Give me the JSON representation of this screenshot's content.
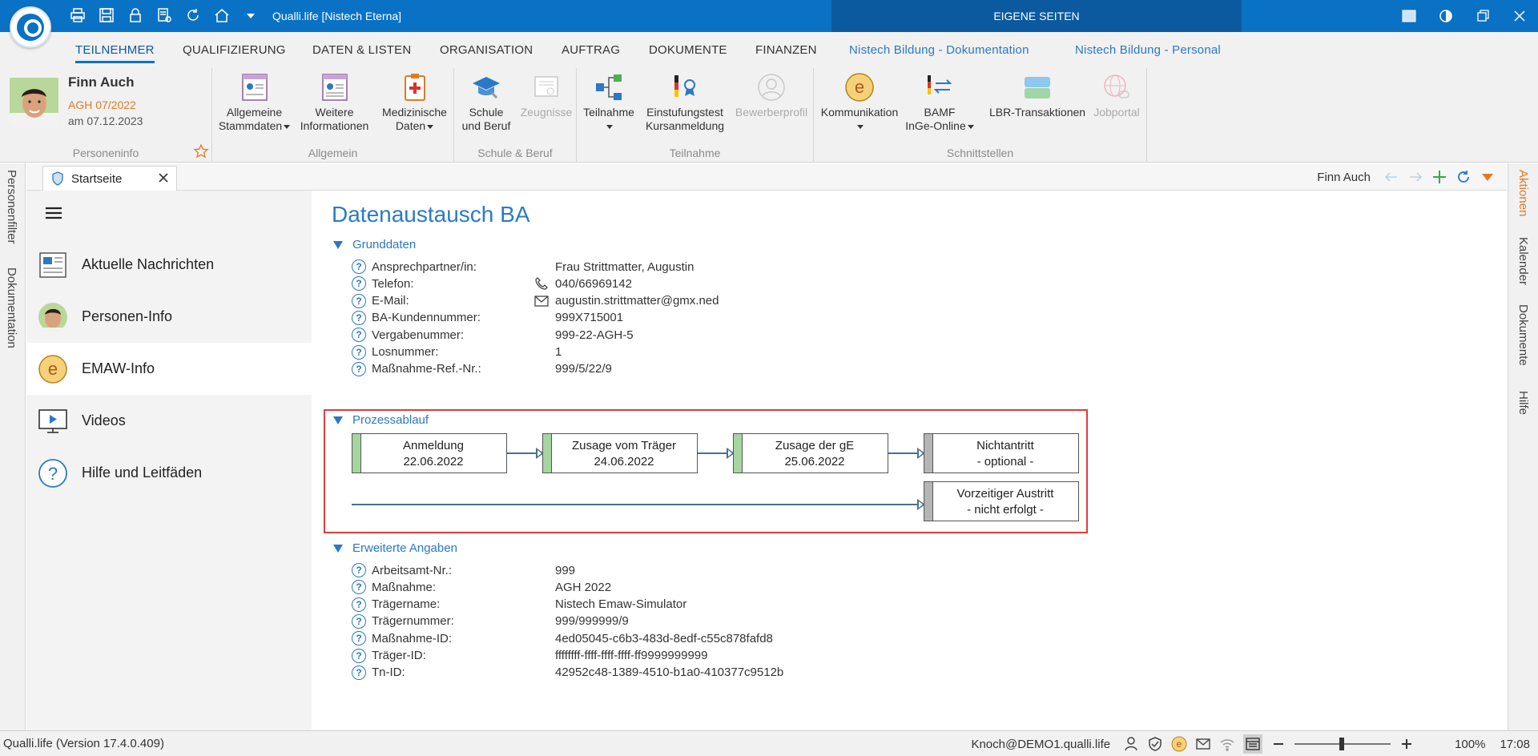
{
  "titlebar": {
    "app_title": "Qualli.life [Nistech Eterna]",
    "eigene_seiten": "EIGENE SEITEN",
    "quick_access": [
      "print-icon",
      "save-icon",
      "lock-icon",
      "form-settings-icon",
      "refresh-icon",
      "home-icon",
      "dropdown-icon"
    ],
    "window_controls": [
      "theme-square-icon",
      "contrast-icon",
      "restore-icon",
      "close-icon"
    ],
    "accent": "#0a72c4"
  },
  "ribbon_tabs": [
    "TEILNEHMER",
    "QUALIFIZIERUNG",
    "DATEN & LISTEN",
    "ORGANISATION",
    "AUFTRAG",
    "DOKUMENTE",
    "FINANZEN",
    "Nistech Bildung - Dokumentation",
    "Nistech Bildung - Personal"
  ],
  "person": {
    "name": "Finn Auch",
    "agh": "AGH 07/2022",
    "date": "am 07.12.2023",
    "group_label": "Personeninfo"
  },
  "ribbon": {
    "allgemein": {
      "label": "Allgemein",
      "b1": [
        "Allgemeine",
        "Stammdaten"
      ],
      "b2": [
        "Weitere",
        "Informationen"
      ],
      "b3": [
        "Medizinische",
        "Daten"
      ]
    },
    "schule": {
      "label": "Schule & Beruf",
      "b1": [
        "Schule",
        "und Beruf"
      ],
      "b2": "Zeugnisse"
    },
    "teilnahme": {
      "label": "Teilnahme",
      "b1": "Teilnahme",
      "b2": [
        "Einstufungstest",
        "Kursanmeldung"
      ],
      "b3": "Bewerberprofil"
    },
    "schnittstellen": {
      "label": "Schnittstellen",
      "b1": "Kommunikation",
      "b2": [
        "BAMF",
        "InGe-Online"
      ],
      "b3": "LBR-Transaktionen",
      "b4": "Jobportal"
    }
  },
  "left_strip": [
    "Personenfilter",
    "Dokumentation"
  ],
  "right_strip": [
    "Aktionen",
    "Kalender",
    "Dokumente",
    "Hilfe"
  ],
  "tabstrip": {
    "tab_label": "Startseite",
    "person_name": "Finn Auch"
  },
  "nav": [
    {
      "label": "Aktuelle Nachrichten",
      "icon": "news-icon"
    },
    {
      "label": "Personen-Info",
      "icon": "person-photo-icon"
    },
    {
      "label": "EMAW-Info",
      "icon": "emaw-e-icon"
    },
    {
      "label": "Videos",
      "icon": "video-monitor-icon"
    },
    {
      "label": "Hilfe und Leitfäden",
      "icon": "help-circle-icon"
    }
  ],
  "content": {
    "title": "Datenaustausch BA",
    "grunddaten": {
      "heading": "Grunddaten",
      "rows": [
        {
          "label": "Ansprechpartner/in:",
          "value": "Frau Strittmatter, Augustin"
        },
        {
          "label": "Telefon:",
          "value": "040/66969142"
        },
        {
          "label": "E-Mail:",
          "value": "augustin.strittmatter@gmx.ned"
        },
        {
          "label": "BA-Kundennummer:",
          "value": "999X715001"
        },
        {
          "label": "Vergabenummer:",
          "value": "999-22-AGH-5"
        },
        {
          "label": "Losnummer:",
          "value": "1"
        },
        {
          "label": "Maßnahme-Ref.-Nr.:",
          "value": "999/5/22/9"
        }
      ]
    },
    "prozess": {
      "heading": "Prozessablauf",
      "steps": [
        {
          "title": "Anmeldung",
          "sub": "22.06.2022",
          "status": "done"
        },
        {
          "title": "Zusage vom Träger",
          "sub": "24.06.2022",
          "status": "done"
        },
        {
          "title": "Zusage der gE",
          "sub": "25.06.2022",
          "status": "done"
        },
        {
          "title": "Nichtantritt",
          "sub": "- optional -",
          "status": "pending"
        },
        {
          "title": "Vorzeitiger Austritt",
          "sub": "- nicht erfolgt -",
          "status": "pending"
        }
      ],
      "status_colors": {
        "done": "#a6d6a0",
        "pending": "#b5b5b5"
      }
    },
    "erweitert": {
      "heading": "Erweiterte Angaben",
      "rows": [
        {
          "label": "Arbeitsamt-Nr.:",
          "value": "999"
        },
        {
          "label": "Maßnahme:",
          "value": "AGH 2022"
        },
        {
          "label": "Trägername:",
          "value": "Nistech Emaw-Simulator"
        },
        {
          "label": "Trägernummer:",
          "value": "999/999999/9"
        },
        {
          "label": "Maßnahme-ID:",
          "value": "4ed05045-c6b3-483d-8edf-c55c878fafd8"
        },
        {
          "label": "Träger-ID:",
          "value": "ffffffff-ffff-ffff-ffff-ff9999999999"
        },
        {
          "label": "Tn-ID:",
          "value": "42952c48-1389-4510-b1a0-410377c9512b"
        }
      ]
    }
  },
  "statusbar": {
    "version": "Qualli.life (Version 17.4.0.409)",
    "user": "Knoch@DEMO1.qualli.life",
    "zoom": "100%",
    "time": "17:08"
  }
}
